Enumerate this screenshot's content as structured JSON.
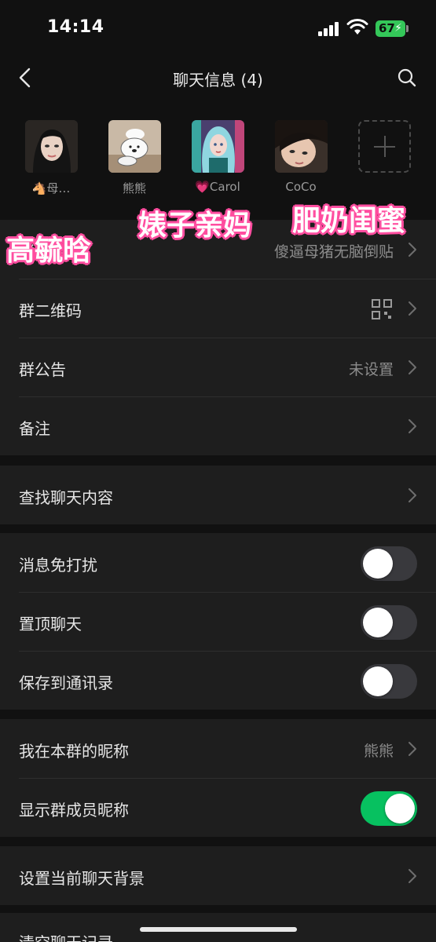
{
  "status_bar": {
    "time": "14:14",
    "battery": "67"
  },
  "nav": {
    "title": "聊天信息 (4)"
  },
  "members": [
    {
      "name": "🐴母…"
    },
    {
      "name": "熊熊"
    },
    {
      "name": "💗Carol"
    },
    {
      "name": "CoCo"
    }
  ],
  "stickers": {
    "first": "高毓晗",
    "second": "婊子亲妈",
    "third": "肥奶闺蜜"
  },
  "group1": {
    "group_name_label": "群聊名称",
    "group_name_value": "傻逼母猪无脑倒贴",
    "qr_label": "群二维码",
    "notice_label": "群公告",
    "notice_value": "未设置",
    "remark_label": "备注"
  },
  "group2": {
    "search_label": "查找聊天内容"
  },
  "group3": {
    "mute_label": "消息免打扰",
    "mute_on": false,
    "pin_label": "置顶聊天",
    "pin_on": false,
    "save_label": "保存到通讯录",
    "save_on": false
  },
  "group4": {
    "nickname_label": "我在本群的昵称",
    "nickname_value": "熊熊",
    "show_nick_label": "显示群成员昵称",
    "show_nick_on": true
  },
  "group5": {
    "bg_label": "设置当前聊天背景"
  },
  "group6": {
    "clear_label": "清空聊天记录"
  },
  "colors": {
    "accent_green": "#07c160",
    "sticker_pink": "#ff4fa0"
  }
}
